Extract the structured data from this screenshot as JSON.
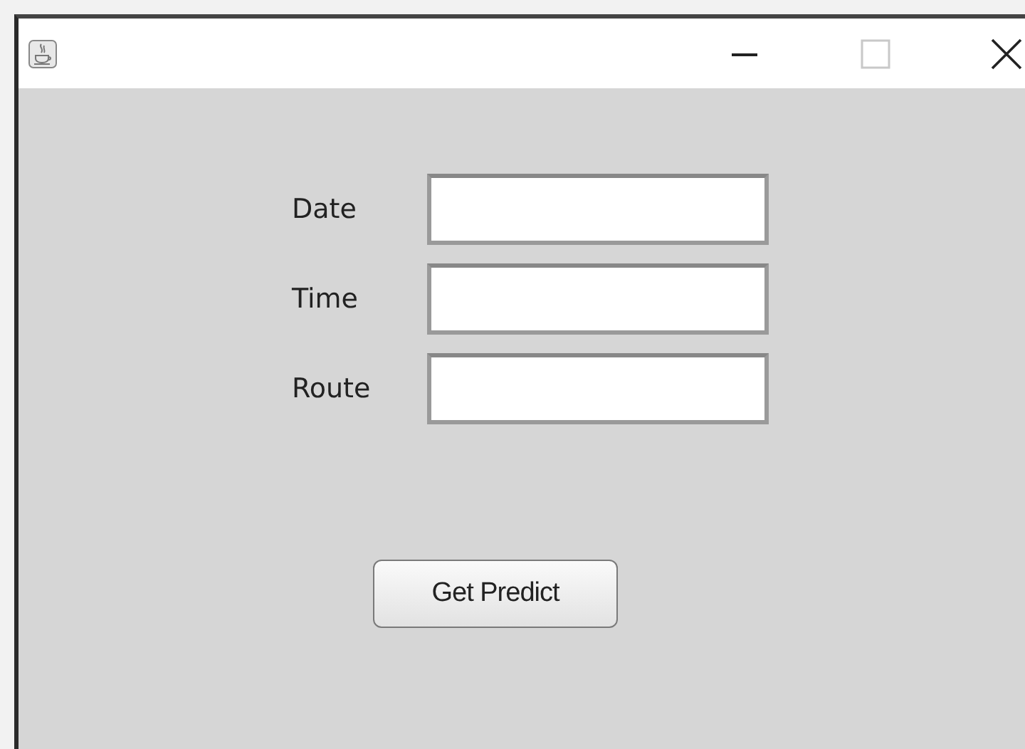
{
  "fields": [
    {
      "label": "Date"
    },
    {
      "label": "Time"
    },
    {
      "label": "Route"
    }
  ],
  "button": "Get Predict"
}
